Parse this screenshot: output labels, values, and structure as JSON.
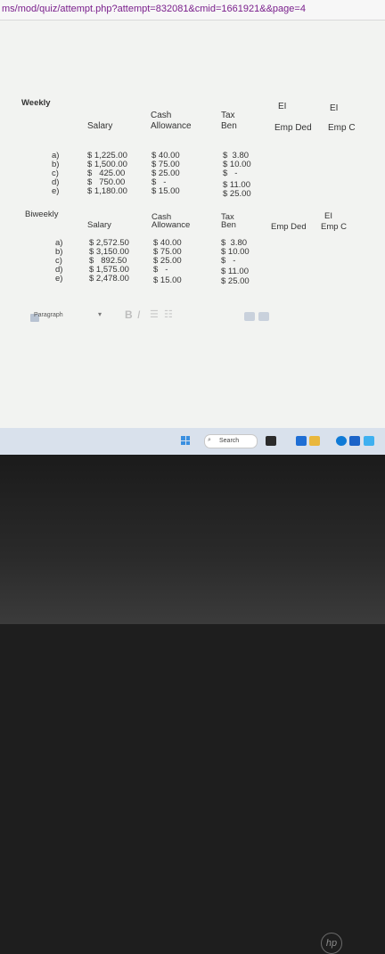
{
  "browser": {
    "url": "ms/mod/quiz/attempt.php?attempt=832081&cmid=1661921&&page=4"
  },
  "weekly": {
    "title": "Weekly",
    "headers": {
      "salary": "Salary",
      "cash1": "Cash",
      "cash2": "Allowance",
      "tax1": "Tax",
      "tax2": "Ben",
      "ei_ded_top": "EI",
      "ei_ded": "Emp Ded",
      "ei_c_top": "EI",
      "ei_c": "Emp C"
    },
    "rows": [
      {
        "label": "a)",
        "salary": "$ 1,225.00",
        "cash": "$ 40.00",
        "tax": "$  3.80"
      },
      {
        "label": "b)",
        "salary": "$ 1,500.00",
        "cash": "$ 75.00",
        "tax": "$ 10.00"
      },
      {
        "label": "c)",
        "salary": "$   425.00",
        "cash": "$ 25.00",
        "tax": "$   -"
      },
      {
        "label": "d)",
        "salary": "$   750.00",
        "cash": "$   -",
        "tax": "$ 11.00"
      },
      {
        "label": "e)",
        "salary": "$ 1,180.00",
        "cash": "$ 15.00",
        "tax": "$ 25.00"
      }
    ]
  },
  "biweekly": {
    "title": "Biweekly",
    "headers": {
      "salary": "Salary",
      "cash1": "Cash",
      "cash2": "Allowance",
      "tax1": "Tax",
      "tax2": "Ben",
      "ei_ded": "Emp Ded",
      "ei_c_top": "EI",
      "ei_c": "Emp C"
    },
    "rows": [
      {
        "label": "a)",
        "salary": "$ 2,572.50",
        "cash": "$ 40.00",
        "tax": "$  3.80"
      },
      {
        "label": "b)",
        "salary": "$ 3,150.00",
        "cash": "$ 75.00",
        "tax": "$ 10.00"
      },
      {
        "label": "c)",
        "salary": "$   892.50",
        "cash": "$ 25.00",
        "tax": "$   -"
      },
      {
        "label": "d)",
        "salary": "$ 1,575.00",
        "cash": "$   -",
        "tax": "$ 11.00"
      },
      {
        "label": "e)",
        "salary": "$ 2,478.00",
        "cash": "$ 15.00",
        "tax": "$ 25.00"
      }
    ]
  },
  "editor": {
    "paragraph_label": "Paragraph",
    "bold": "B",
    "italic": "I"
  },
  "taskbar": {
    "search_label": "Search"
  },
  "colors": {
    "url": "#7a1f8c",
    "background": "#f2f3f1",
    "taskbar": "#d9e1ec"
  }
}
